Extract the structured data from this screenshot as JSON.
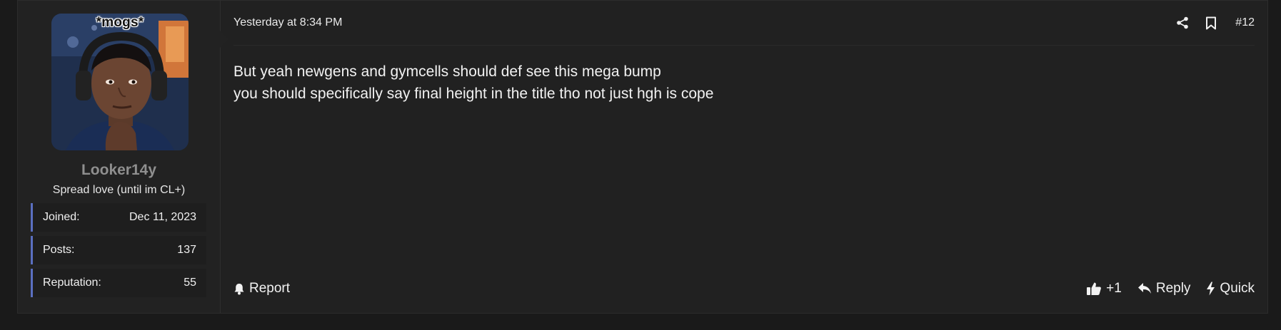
{
  "user": {
    "avatar_caption": "*mogs*",
    "username": "Looker14y",
    "title": "Spread love (until im CL+)",
    "stats": [
      {
        "label": "Joined:",
        "value": "Dec 11, 2023"
      },
      {
        "label": "Posts:",
        "value": "137"
      },
      {
        "label": "Reputation:",
        "value": "55"
      }
    ]
  },
  "post": {
    "timestamp": "Yesterday at 8:34 PM",
    "number": "#12",
    "body_lines": [
      "But yeah newgens and gymcells should def see this mega bump",
      "you should specifically say final height in the title tho not just hgh is cope"
    ]
  },
  "actions": {
    "report": "Report",
    "like": "+1",
    "reply": "Reply",
    "quick": "Quick"
  },
  "colors": {
    "page_bg": "#1a1a1a",
    "post_bg": "#212121",
    "stat_accent": "#5a6fc0",
    "username": "#8f8f8f",
    "text": "#f2f2f2"
  },
  "icons": {
    "share": "share-icon",
    "bookmark": "bookmark-icon",
    "report": "bell-icon",
    "like": "thumbs-up-icon",
    "reply": "reply-arrow-icon",
    "quick": "lightning-bolt-icon"
  }
}
